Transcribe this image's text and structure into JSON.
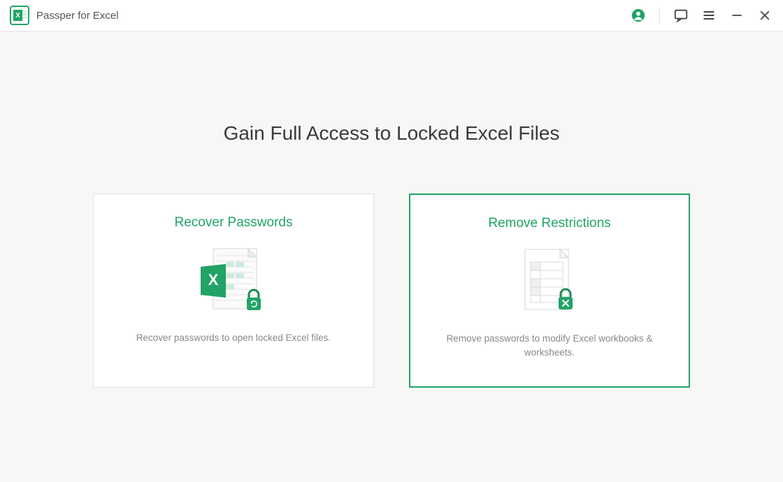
{
  "app": {
    "title": "Passper for Excel"
  },
  "headline": "Gain Full Access to Locked Excel Files",
  "cards": {
    "recover": {
      "title": "Recover Passwords",
      "desc": "Recover passwords to open locked Excel files."
    },
    "remove": {
      "title": "Remove Restrictions",
      "desc": "Remove passwords to modify Excel workbooks & worksheets."
    }
  },
  "colors": {
    "accent": "#21a366"
  }
}
